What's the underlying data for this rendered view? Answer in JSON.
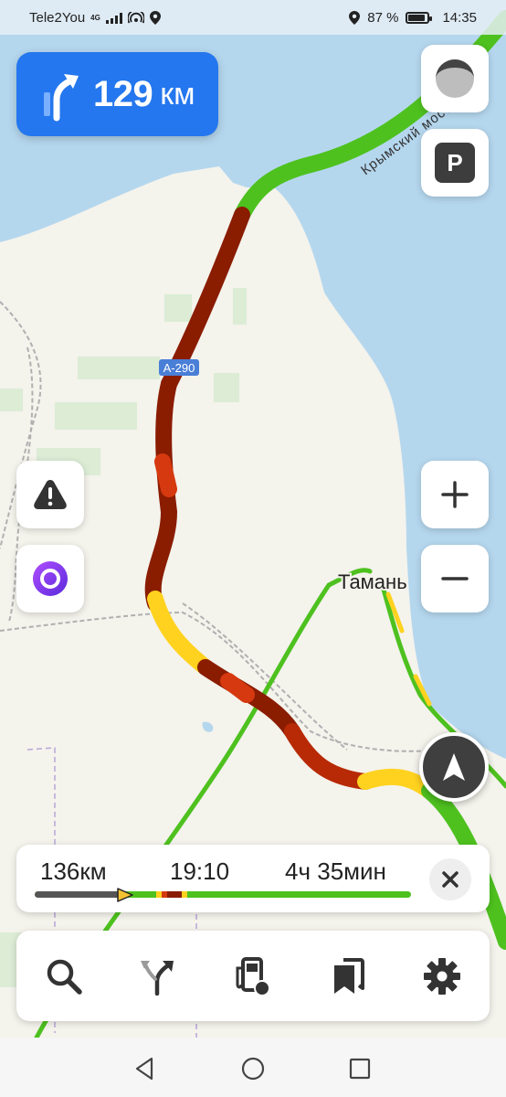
{
  "status_bar": {
    "carrier": "Tele2You",
    "network": "4G",
    "battery_percent": "87 %",
    "battery_level": 0.87,
    "time": "14:35"
  },
  "maneuver": {
    "distance": "129",
    "unit": "км",
    "icon": "turn-right-arrow-icon"
  },
  "map": {
    "road_label_highway": "А-290",
    "road_label_bridge": "Крымский мост",
    "city_label": "Тамань",
    "colors": {
      "sea": "#b5d7ee",
      "land": "#f4f3ec",
      "fields": "#dcecd5",
      "free_traffic": "#4ec11f",
      "slow_traffic": "#ffd21f",
      "jam_traffic": "#8a1c00",
      "heavy_traffic": "#d6390f"
    }
  },
  "map_controls": {
    "compass": "compass-icon",
    "parking": "P",
    "zoom_in": "+",
    "zoom_out": "−",
    "report": "warning-icon",
    "alice": "alice-icon",
    "navigation": "navigation-arrow-icon"
  },
  "route_summary": {
    "distance": "136км",
    "arrival_time": "19:10",
    "duration": "4ч 35мин",
    "progress_fraction": 0.24
  },
  "toolbar": {
    "items": [
      "search-icon",
      "route-alternatives-icon",
      "gas-station-icon",
      "bookmarks-icon",
      "settings-icon"
    ]
  },
  "android_nav": {
    "items": [
      "back-icon",
      "home-icon",
      "recents-icon"
    ]
  }
}
